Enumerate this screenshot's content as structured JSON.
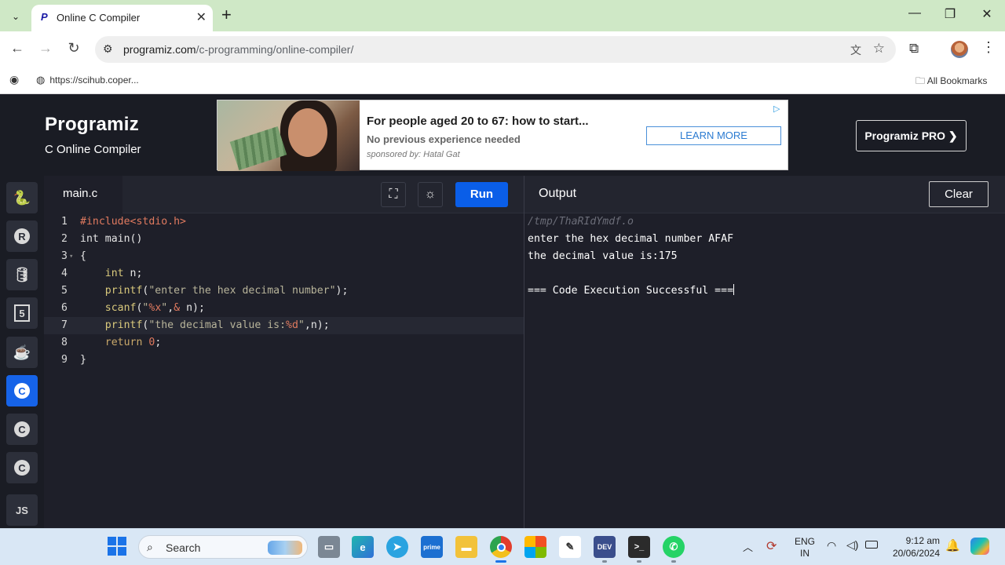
{
  "browser": {
    "tab_title": "Online C Compiler",
    "tab_close": "✕",
    "new_tab": "+",
    "url_domain": "programiz.com",
    "url_path": "/c-programming/online-compiler/",
    "bookmark_item": "https://scihub.coper...",
    "all_bookmarks": "All Bookmarks"
  },
  "header": {
    "logo": "Programiz",
    "subtitle": "C Online Compiler",
    "pro_button": "Programiz PRO ❯"
  },
  "ad": {
    "title": "For people aged 20 to 67: how to start...",
    "subtitle": "No previous experience needed",
    "sponsor": "sponsored by: Hatal Gat",
    "cta": "LEARN MORE"
  },
  "sidebar": {
    "items": [
      {
        "name": "python",
        "glyph": "🐍"
      },
      {
        "name": "r",
        "glyph": "R"
      },
      {
        "name": "sql",
        "glyph": "🛢"
      },
      {
        "name": "html",
        "glyph": "5"
      },
      {
        "name": "java",
        "glyph": "☕"
      },
      {
        "name": "c",
        "glyph": "C"
      },
      {
        "name": "cpp",
        "glyph": "C"
      },
      {
        "name": "csharp",
        "glyph": "C"
      },
      {
        "name": "js",
        "glyph": "JS"
      }
    ],
    "active": "c"
  },
  "editor": {
    "file_name": "main.c",
    "run_label": "Run",
    "line_numbers": [
      "1",
      "2",
      "3",
      "4",
      "5",
      "6",
      "7",
      "8",
      "9"
    ]
  },
  "output": {
    "title": "Output",
    "clear_label": "Clear",
    "lines": [
      "/tmp/ThaRIdYmdf.o",
      "enter the hex decimal number AFAF",
      "the decimal value is:175",
      "",
      "=== Code Execution Successful ==="
    ]
  },
  "taskbar": {
    "search_label": "Search",
    "language": "ENG",
    "region": "IN",
    "time": "9:12 am",
    "date": "20/06/2024"
  },
  "colors": {
    "run_button": "#0a5ee8",
    "active_language": "#1663e8",
    "editor_bg": "#1e1f29",
    "header_bg": "#1a1c24"
  }
}
